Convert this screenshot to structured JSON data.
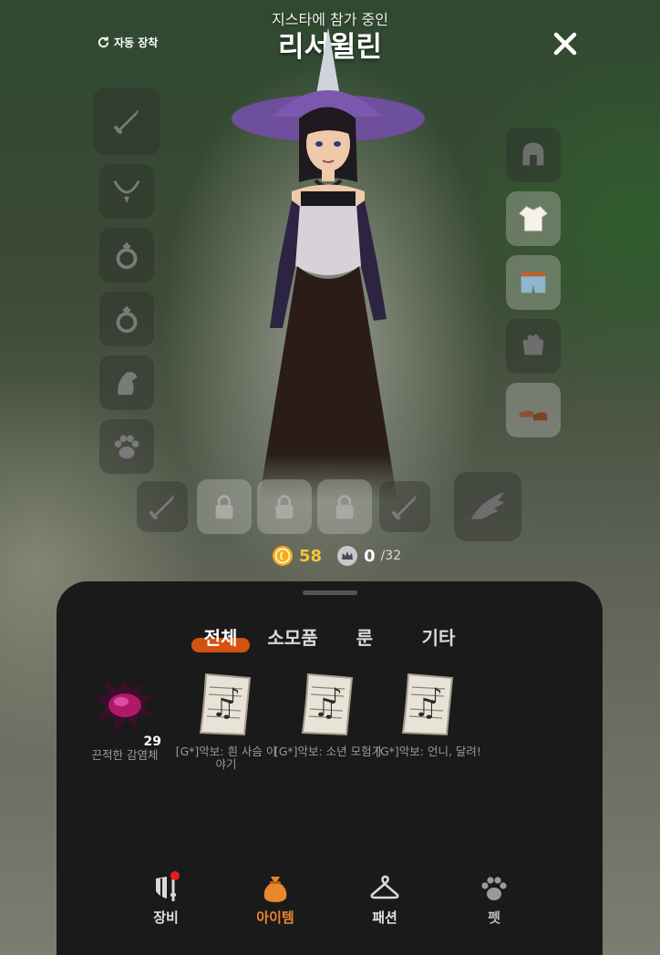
{
  "header": {
    "status": "지스타에 참가 중인",
    "character_name": "리서윌린",
    "auto_equip_label": "자동 장착"
  },
  "currency": {
    "coin_value": "58",
    "capacity_value": "0",
    "capacity_max": "/32"
  },
  "inventory": {
    "tabs": [
      {
        "label": "전체",
        "active": true
      },
      {
        "label": "소모품",
        "active": false
      },
      {
        "label": "룬",
        "active": false
      },
      {
        "label": "기타",
        "active": false
      }
    ],
    "items": [
      {
        "name": "끈적한 감염체",
        "count": "29",
        "icon": "infected-blob-icon"
      },
      {
        "name": "[G*]악보: 흰 사슴 이야기",
        "icon": "music-sheet-icon"
      },
      {
        "name": "[G*]악보: 소년 모험가",
        "icon": "music-sheet-icon"
      },
      {
        "name": "[G*]악보: 언니, 달려!",
        "icon": "music-sheet-icon"
      }
    ]
  },
  "bottom_nav": [
    {
      "label": "장비",
      "icon": "equipment-icon",
      "active": false,
      "badge": true
    },
    {
      "label": "아이템",
      "icon": "item-bag-icon",
      "active": true,
      "badge": false
    },
    {
      "label": "패션",
      "icon": "hanger-icon",
      "active": false,
      "badge": false
    },
    {
      "label": "펫",
      "icon": "paw-icon",
      "active": false,
      "badge": false
    }
  ],
  "colors": {
    "accent": "#d4520f",
    "active_nav": "#e8872d",
    "coin": "#f6c33a",
    "badge": "#e01e1e"
  }
}
